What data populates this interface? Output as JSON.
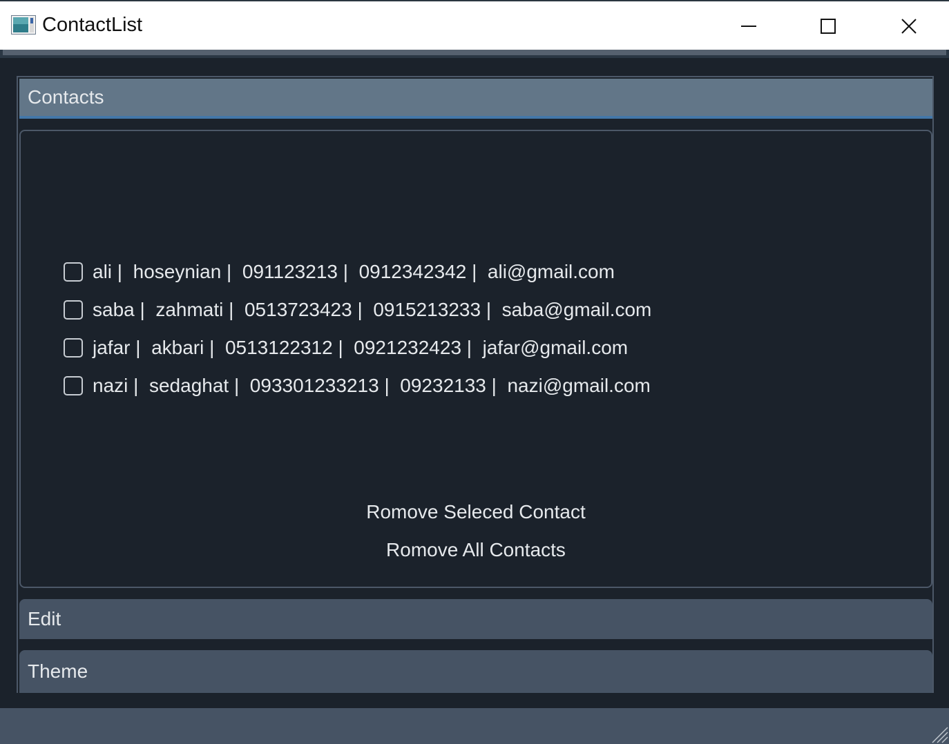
{
  "window": {
    "title": "ContactList",
    "icon": "app-window-icon",
    "controls": [
      "minimize-icon",
      "maximize-icon",
      "close-icon"
    ]
  },
  "accordion": {
    "contacts_label": "Contacts",
    "edit_label": "Edit",
    "theme_label": "Theme"
  },
  "contacts": [
    {
      "text": "ali |  hoseynian |  091123213 |  0912342342 |  ali@gmail.com",
      "checked": false
    },
    {
      "text": "saba |  zahmati |  0513723423 |  0915213233 |  saba@gmail.com",
      "checked": false
    },
    {
      "text": "jafar |  akbari |  0513122312 |  0921232423 |  jafar@gmail.com",
      "checked": false
    },
    {
      "text": "nazi |  sedaghat |  093301233213 |  09232133 |  nazi@gmail.com",
      "checked": false
    }
  ],
  "actions": {
    "remove_selected": "Romove Seleced Contact",
    "remove_all": "Romove All Contacts"
  },
  "colors": {
    "background": "#1b222b",
    "active_header": "#627688",
    "header": "#465364",
    "accent": "#4477a8",
    "text": "#e6e9ec"
  }
}
